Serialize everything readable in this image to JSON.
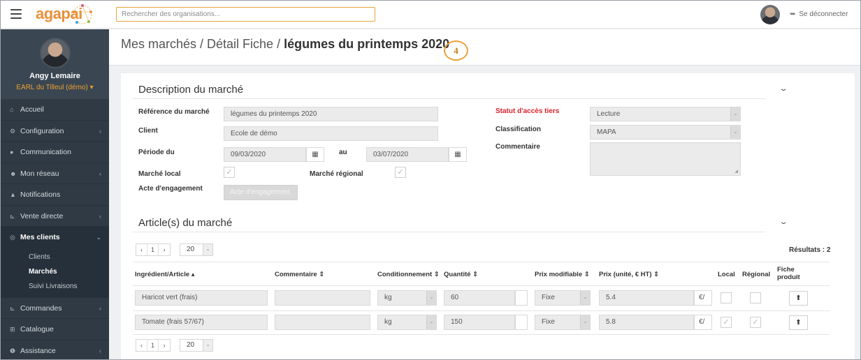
{
  "header": {
    "logo_text": "agapai",
    "search_placeholder": "Rechercher des organisations...",
    "logout_label": "Se déconnecter"
  },
  "sidebar": {
    "user_name": "Angy Lemaire",
    "org_name": "EARL du Tilleul (démo)",
    "items": [
      {
        "label": "Accueil",
        "icon": "home-icon"
      },
      {
        "label": "Configuration",
        "icon": "gears-icon"
      },
      {
        "label": "Communication",
        "icon": "chat-icon"
      },
      {
        "label": "Mon réseau",
        "icon": "users-icon"
      },
      {
        "label": "Notifications",
        "icon": "bell-icon"
      },
      {
        "label": "Vente directe",
        "icon": "cart-icon"
      },
      {
        "label": "Mes clients",
        "icon": "handshake-icon"
      },
      {
        "label": "Commandes",
        "icon": "cart-icon"
      },
      {
        "label": "Catalogue",
        "icon": "basket-icon"
      },
      {
        "label": "Assistance",
        "icon": "info-icon"
      }
    ],
    "sub_items": [
      {
        "label": "Clients"
      },
      {
        "label": "Marchés"
      },
      {
        "label": "Suivi Livraisons"
      }
    ]
  },
  "page": {
    "breadcrumb_prefix": "Mes marchés / Détail Fiche / ",
    "breadcrumb_current": "légumes du printemps 2020",
    "step_number": "4"
  },
  "description": {
    "section_title": "Description du marché",
    "reference_label": "Référence du marché",
    "reference_value": "légumes du printemps 2020",
    "client_label": "Client",
    "client_value": "Ecole de démo",
    "period_label": "Période du",
    "period_from": "09/03/2020",
    "period_to_label": "au",
    "period_to": "03/07/2020",
    "local_label": "Marché local",
    "regional_label": "Marché régional",
    "acte_label": "Acte d'engagement",
    "acte_button": "Acte d'engagement",
    "statut_label": "Statut d'accès tiers",
    "statut_value": "Lecture",
    "classification_label": "Classification",
    "classification_value": "MAPA",
    "commentaire_label": "Commentaire"
  },
  "articles": {
    "section_title": "Article(s) du marché",
    "pager_page": "1",
    "per_page": "20",
    "results_label": "Résultats : 2",
    "columns": {
      "article": "Ingrédient/Article",
      "commentaire": "Commentaire",
      "conditionnement": "Conditionnement",
      "quantite": "Quantité",
      "prix_modifiable": "Prix modifiable",
      "prix": "Prix (unité, € HT)",
      "local": "Local",
      "regional": "Régional",
      "fiche_line1": "Fiche",
      "fiche_line2": "produit"
    },
    "rows": [
      {
        "article": "Haricot vert (frais)",
        "commentaire": "",
        "conditionnement": "kg",
        "quantite": "60",
        "prix_modifiable": "Fixe",
        "prix": "5.4",
        "unit": "€/",
        "local": false,
        "regional": false
      },
      {
        "article": "Tomate (frais  57/67)",
        "commentaire": "",
        "conditionnement": "kg",
        "quantite": "150",
        "prix_modifiable": "Fixe",
        "prix": "5.8",
        "unit": "€/",
        "local": true,
        "regional": true
      }
    ]
  }
}
